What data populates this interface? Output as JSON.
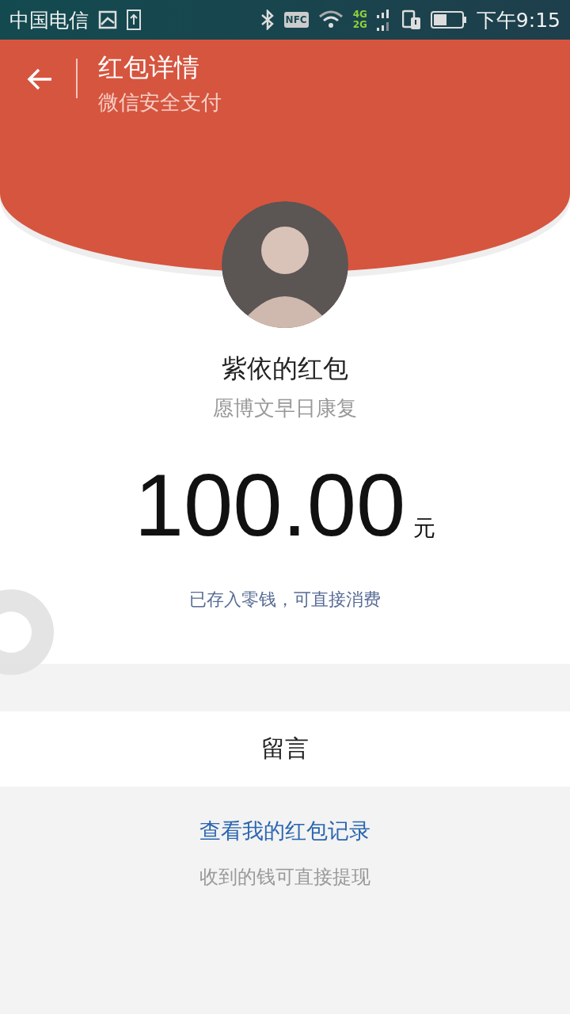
{
  "status_bar": {
    "carrier": "中国电信",
    "time": "下午9:15",
    "network_top": "4G",
    "network_bottom": "2G",
    "nfc": "NFC"
  },
  "header": {
    "title": "红包详情",
    "subtitle": "微信安全支付"
  },
  "sender": {
    "name": "紫依的红包",
    "wish": "愿博文早日康复"
  },
  "amount": {
    "value": "100.00",
    "unit": "元"
  },
  "note": "已存入零钱，可直接消费",
  "message_label": "留言",
  "footer": {
    "link": "查看我的红包记录",
    "hint": "收到的钱可直接提现"
  }
}
